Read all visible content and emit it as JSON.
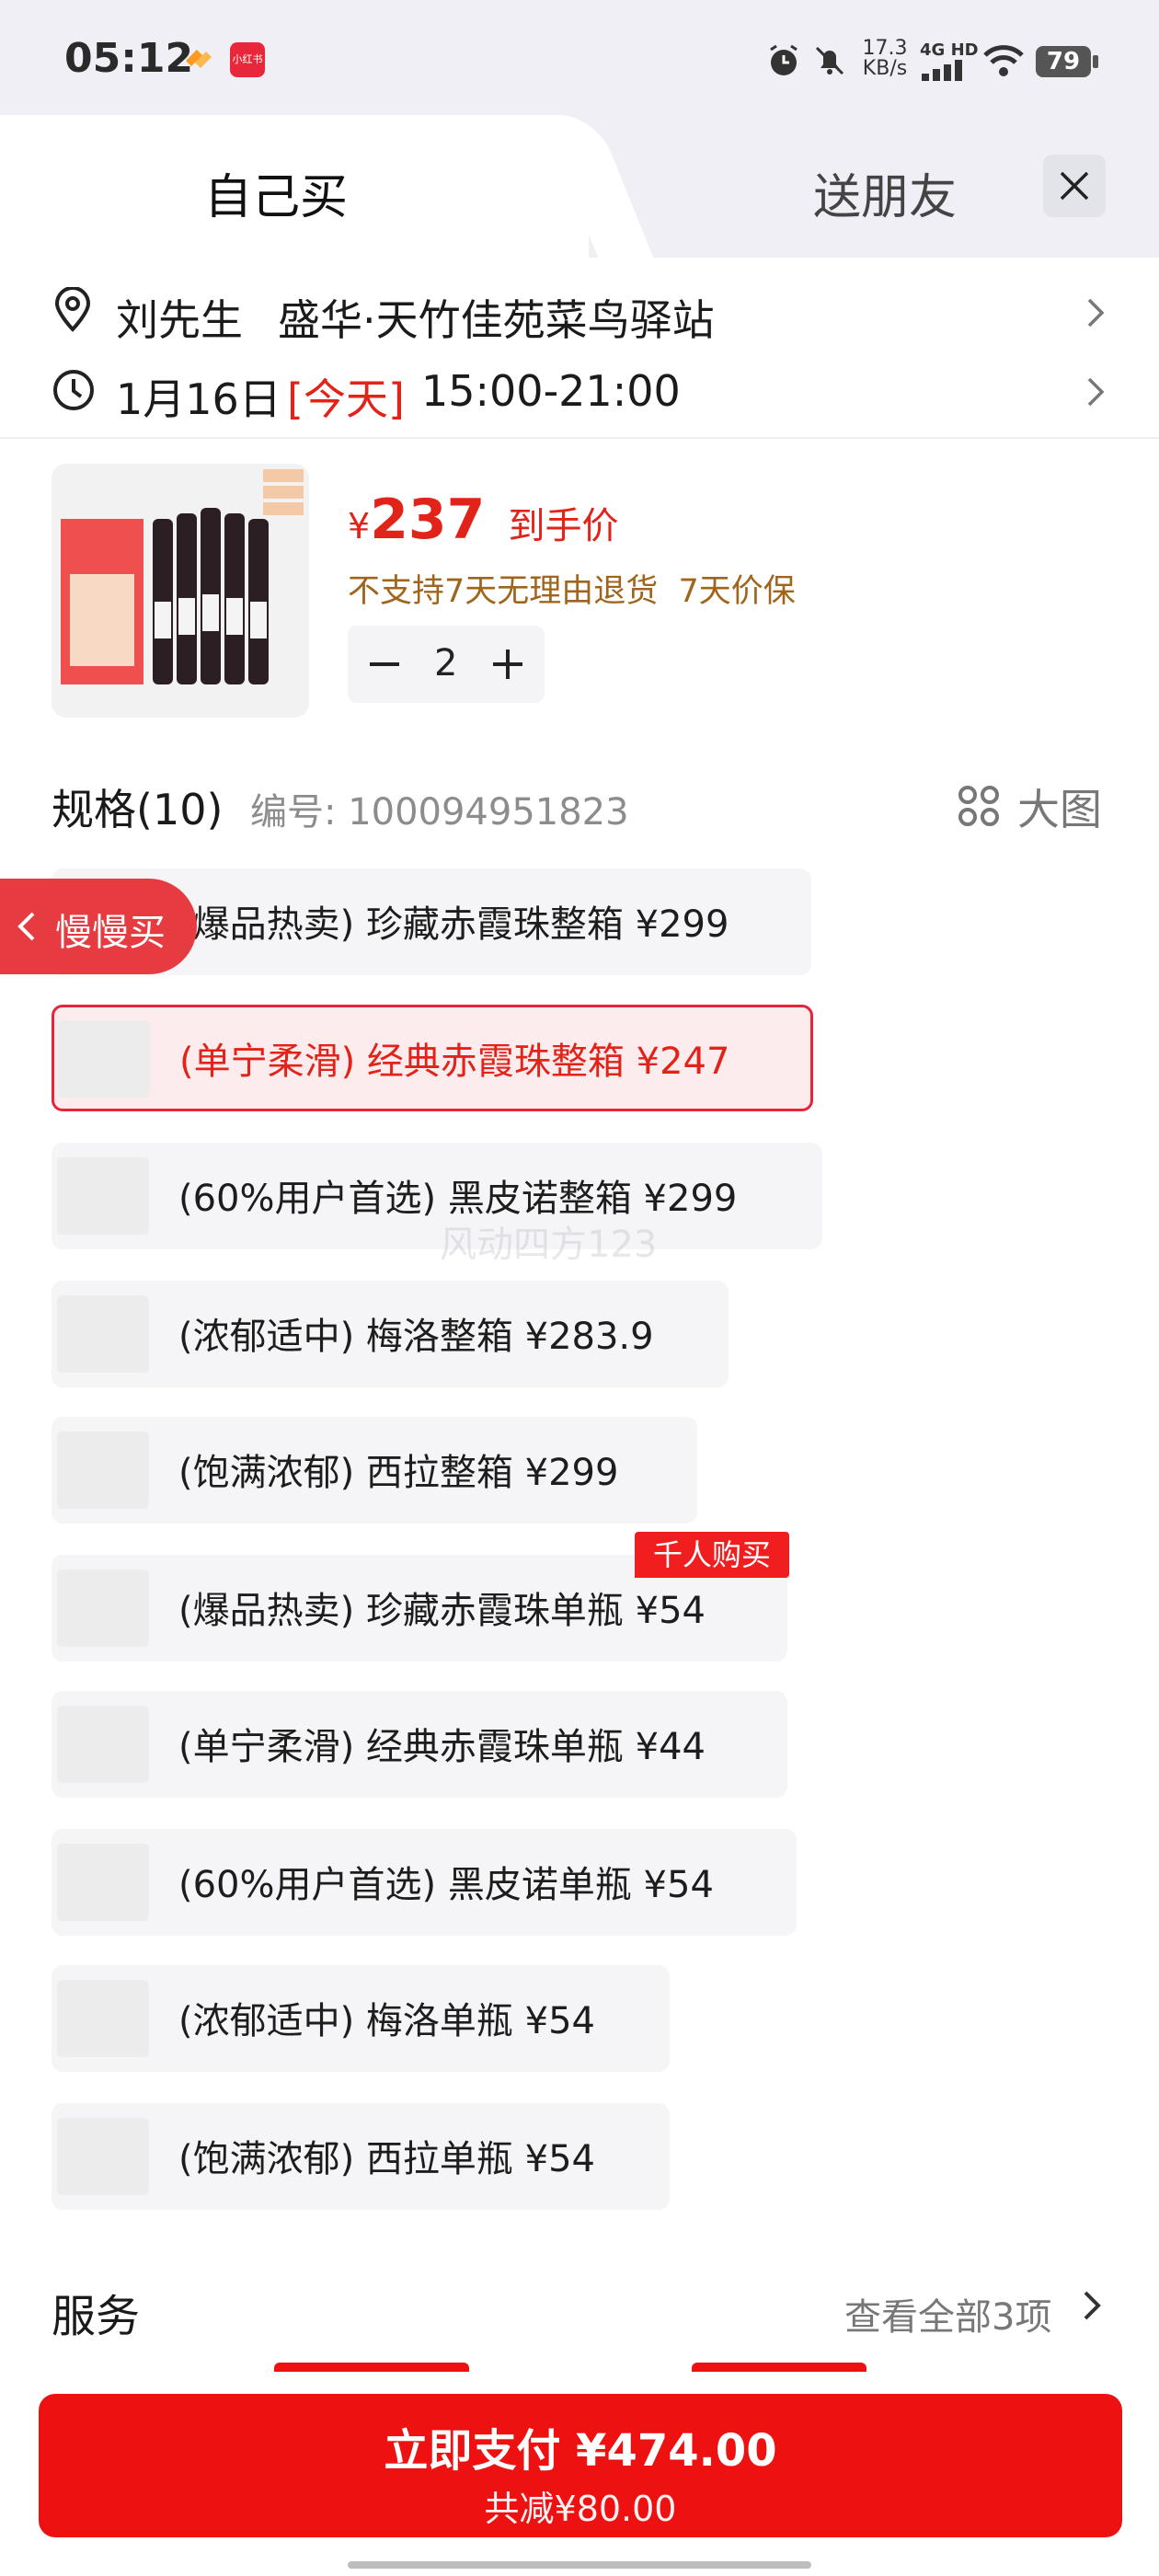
{
  "status_bar": {
    "time": "05:12",
    "app_badge": "小红书",
    "net_speed": "17.3",
    "net_unit": "KB/s",
    "network": "4G HD",
    "battery": "79"
  },
  "tabs": {
    "self": "自己买",
    "friend": "送朋友"
  },
  "address": {
    "name": "刘先生",
    "place": "盛华·天竹佳苑菜鸟驿站"
  },
  "delivery": {
    "date": "1月16日",
    "today": "[今天]",
    "window": "15:00-21:00"
  },
  "product": {
    "yen": "¥",
    "price": "237",
    "price_label": "到手价",
    "policy": "不支持7天无理由退货  7天价保",
    "quantity": "2"
  },
  "specs": {
    "title": "规格(10)",
    "code": "编号: 100094951823",
    "big_image": "大图",
    "items": [
      {
        "label": "(爆品热卖) 珍藏赤霞珠整箱   ¥299"
      },
      {
        "label": "(单宁柔滑) 经典赤霞珠整箱   ¥247"
      },
      {
        "label": "(60%用户首选) 黑皮诺整箱   ¥299"
      },
      {
        "label": "(浓郁适中) 梅洛整箱   ¥283.9"
      },
      {
        "label": "(饱满浓郁) 西拉整箱   ¥299"
      },
      {
        "label": "(爆品热卖) 珍藏赤霞珠单瓶   ¥54"
      },
      {
        "label": "(单宁柔滑) 经典赤霞珠单瓶   ¥44"
      },
      {
        "label": "(60%用户首选) 黑皮诺单瓶   ¥54"
      },
      {
        "label": "(浓郁适中) 梅洛单瓶   ¥54"
      },
      {
        "label": "(饱满浓郁) 西拉单瓶   ¥54"
      }
    ],
    "hot_badge": "千人购买"
  },
  "slow_buy": "慢慢买",
  "watermark": "风动四方123",
  "service": {
    "title": "服务",
    "view_all": "查看全部3项"
  },
  "pay": {
    "main": "立即支付 ¥474.00",
    "sub": "共减¥80.00"
  },
  "colors": {
    "accent": "#e2231a",
    "button": "#ee1111",
    "policy": "#a0651c"
  }
}
